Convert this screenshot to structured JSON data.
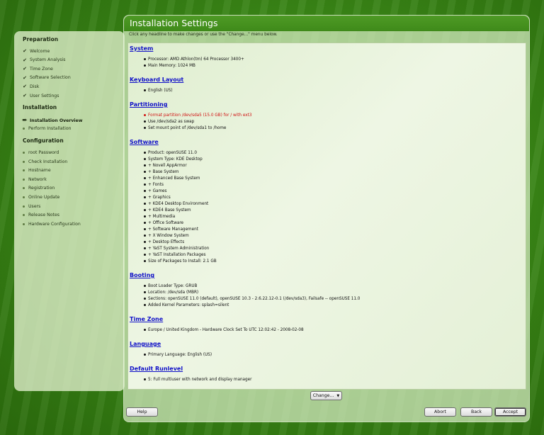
{
  "sidebar": {
    "sections": [
      {
        "title": "Preparation",
        "steps": [
          {
            "label": "Welcome",
            "state": "done"
          },
          {
            "label": "System Analysis",
            "state": "done"
          },
          {
            "label": "Time Zone",
            "state": "done"
          },
          {
            "label": "Software Selection",
            "state": "done"
          },
          {
            "label": "Disk",
            "state": "done"
          },
          {
            "label": "User Settings",
            "state": "done"
          }
        ]
      },
      {
        "title": "Installation",
        "steps": [
          {
            "label": "Installation Overview",
            "state": "current"
          },
          {
            "label": "Perform Installation",
            "state": "pending"
          }
        ]
      },
      {
        "title": "Configuration",
        "steps": [
          {
            "label": "root Password",
            "state": "pending"
          },
          {
            "label": "Check Installation",
            "state": "pending"
          },
          {
            "label": "Hostname",
            "state": "pending"
          },
          {
            "label": "Network",
            "state": "pending"
          },
          {
            "label": "Registration",
            "state": "pending"
          },
          {
            "label": "Online Update",
            "state": "pending"
          },
          {
            "label": "Users",
            "state": "pending"
          },
          {
            "label": "Release Notes",
            "state": "pending"
          },
          {
            "label": "Hardware Configuration",
            "state": "pending"
          }
        ]
      }
    ]
  },
  "main": {
    "title": "Installation Settings",
    "hint": "Click any headline to make changes or use the \"Change...\" menu below.",
    "sections": [
      {
        "heading": "System",
        "items": [
          {
            "text": "Processor: AMD Athlon(tm) 64 Processor 3400+"
          },
          {
            "text": "Main Memory: 1024 MB"
          }
        ]
      },
      {
        "heading": "Keyboard Layout",
        "items": [
          {
            "text": "English (US)"
          }
        ]
      },
      {
        "heading": "Partitioning",
        "items": [
          {
            "text": "Format partition /dev/sda5 (15.0 GB) for / with ext3",
            "warn": true
          },
          {
            "text": "Use /dev/sda2 as swap"
          },
          {
            "text": "Set mount point of /dev/sda1 to /home"
          }
        ]
      },
      {
        "heading": "Software",
        "items": [
          {
            "text": "Product: openSUSE 11.0"
          },
          {
            "text": "System Type: KDE Desktop"
          },
          {
            "text": "+ Novell AppArmor"
          },
          {
            "text": "+ Base System"
          },
          {
            "text": "+ Enhanced Base System"
          },
          {
            "text": "+ Fonts"
          },
          {
            "text": "+ Games"
          },
          {
            "text": "+ Graphics"
          },
          {
            "text": "+ KDE4 Desktop Environment"
          },
          {
            "text": "+ KDE4 Base System"
          },
          {
            "text": "+ Multimedia"
          },
          {
            "text": "+ Office Software"
          },
          {
            "text": "+ Software Management"
          },
          {
            "text": "+ X Window System"
          },
          {
            "text": "+ Desktop Effects"
          },
          {
            "text": "+ YaST System Administration"
          },
          {
            "text": "+ YaST Installation Packages"
          },
          {
            "text": "Size of Packages to Install: 2.1 GB"
          }
        ]
      },
      {
        "heading": "Booting",
        "items": [
          {
            "text": "Boot Loader Type: GRUB"
          },
          {
            "text": "Location: /dev/sda (MBR)"
          },
          {
            "text": "Sections: openSUSE 11.0 (default), openSUSE 10.3 - 2.6.22.12-0.1 (/dev/sda3), Failsafe -- openSUSE 11.0"
          },
          {
            "text": "Added Kernel Parameters: splash=silent"
          }
        ]
      },
      {
        "heading": "Time Zone",
        "items": [
          {
            "text": "Europe / United Kingdom - Hardware Clock Set To UTC 12:02:42 - 2008-02-08"
          }
        ]
      },
      {
        "heading": "Language",
        "items": [
          {
            "text": "Primary Language: English (US)"
          }
        ]
      },
      {
        "heading": "Default Runlevel",
        "items": [
          {
            "text": "5: Full multiuser with network and display manager"
          }
        ]
      }
    ]
  },
  "buttons": {
    "change": "Change...",
    "help": "Help",
    "abort": "Abort",
    "back": "Back",
    "accept": "Accept"
  },
  "colors": {
    "heading_link": "#1010c8",
    "warning_text": "#d01010",
    "title_bar": "#4e9a25"
  }
}
